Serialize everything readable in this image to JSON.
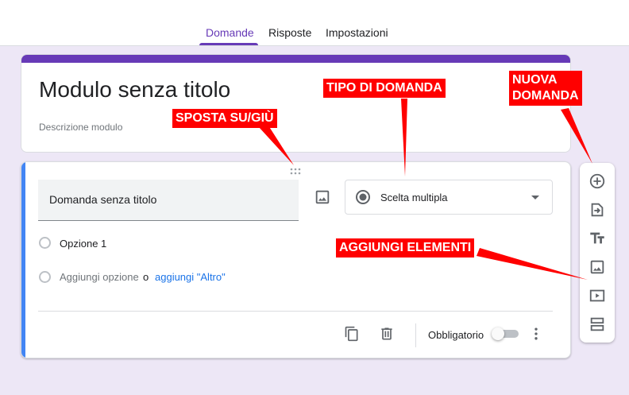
{
  "tabs": [
    {
      "label": "Domande",
      "active": true
    },
    {
      "label": "Risposte",
      "active": false
    },
    {
      "label": "Impostazioni",
      "active": false
    }
  ],
  "form": {
    "title": "Modulo senza titolo",
    "description_placeholder": "Descrizione modulo"
  },
  "question": {
    "title": "Domanda senza titolo",
    "type": "Scelta multipla",
    "option1": "Opzione 1",
    "add_option": "Aggiungi opzione",
    "or": "o",
    "add_other": "aggiungi \"Altro\"",
    "required_label": "Obbligatorio",
    "required": false
  },
  "toolbar": {
    "icons": [
      "add-question-icon",
      "import-questions-icon",
      "add-title-icon",
      "add-image-icon",
      "add-video-icon",
      "add-section-icon"
    ]
  },
  "annotations": {
    "move": "SPOSTA SU/GIÙ",
    "type": "TIPO DI DOMANDA",
    "new_question": "NUOVA\nDOMANDA",
    "add_elements": "AGGIUNGI ELEMENTI"
  },
  "colors": {
    "accent": "#673ab7",
    "page_bg": "#ede7f6",
    "active_question": "#4285f4",
    "link": "#1a73e8",
    "callout": "#ff0000"
  }
}
